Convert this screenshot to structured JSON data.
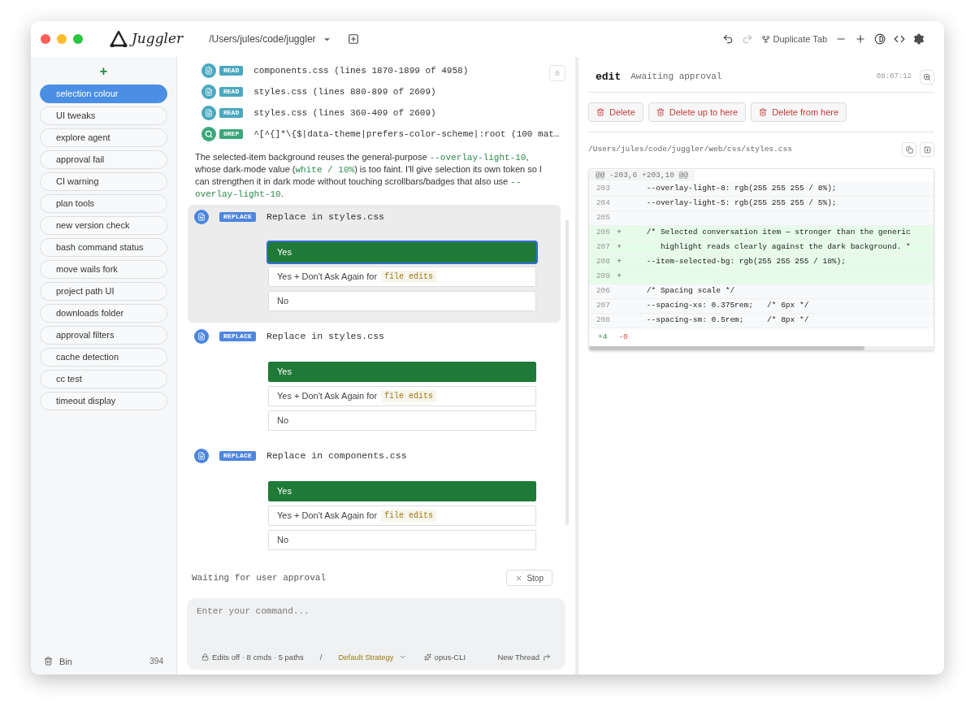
{
  "window": {
    "app_name": "Juggler",
    "project_path": "/Users/jules/code/juggler",
    "toolbar": {
      "duplicate_label": "Duplicate Tab",
      "redo_disabled": true
    }
  },
  "sidebar": {
    "new_button": "+",
    "items": [
      {
        "label": "selection colour",
        "selected": true
      },
      {
        "label": "UI tweaks",
        "selected": false
      },
      {
        "label": "explore agent",
        "selected": false
      },
      {
        "label": "approval fail",
        "selected": false
      },
      {
        "label": "CI warning",
        "selected": false
      },
      {
        "label": "plan tools",
        "selected": false
      },
      {
        "label": "new version check",
        "selected": false
      },
      {
        "label": "bash command status",
        "selected": false
      },
      {
        "label": "move wails fork",
        "selected": false
      },
      {
        "label": "project path UI",
        "selected": false
      },
      {
        "label": "downloads folder",
        "selected": false
      },
      {
        "label": "approval filters",
        "selected": false
      },
      {
        "label": "cache detection",
        "selected": false
      },
      {
        "label": "cc test",
        "selected": false
      },
      {
        "label": "timeout display",
        "selected": false
      }
    ],
    "bin": {
      "label": "Bin",
      "count": "394"
    }
  },
  "conversation": {
    "tool_calls": [
      {
        "kind": "read",
        "badge": "READ",
        "text": "components.css (lines 1870-1899 of 4958)"
      },
      {
        "kind": "read",
        "badge": "READ",
        "text": "styles.css (lines 880-899 of 2609)"
      },
      {
        "kind": "read",
        "badge": "READ",
        "text": "styles.css (lines 360-409 of 2609)"
      },
      {
        "kind": "grep",
        "badge": "GREP",
        "text": "^[^{]*\\{$|data-theme|prefers-color-scheme|:root (100 mat…"
      }
    ],
    "message": [
      {
        "text": "The selected-item background reuses the general-purpose ",
        "code": false
      },
      {
        "text": "--overlay-light-10",
        "code": true
      },
      {
        "text": ", whose dark-mode value (",
        "code": false
      },
      {
        "text": "white / 10%",
        "code": true
      },
      {
        "text": ") is too faint. I'll give selection its own token so I can strengthen it in dark mode without touching scrollbars/badges that also use ",
        "code": false
      },
      {
        "text": "--overlay-light-10",
        "code": true
      },
      {
        "text": ".",
        "code": false
      }
    ],
    "approvals": [
      {
        "badge": "REPLACE",
        "title": "Replace in styles.css",
        "selected": true,
        "options": [
          {
            "kind": "primary",
            "label": "Yes",
            "focused": true
          },
          {
            "kind": "remember",
            "label": "Yes + Don't Ask Again for",
            "code": "file edits",
            "focused": false
          },
          {
            "kind": "plain",
            "label": "No",
            "focused": false
          }
        ]
      },
      {
        "badge": "REPLACE",
        "title": "Replace in styles.css",
        "selected": false,
        "options": [
          {
            "kind": "primary",
            "label": "Yes",
            "focused": false
          },
          {
            "kind": "remember",
            "label": "Yes + Don't Ask Again for",
            "code": "file edits",
            "focused": false
          },
          {
            "kind": "plain",
            "label": "No",
            "focused": false
          }
        ]
      },
      {
        "badge": "REPLACE",
        "title": "Replace in components.css",
        "selected": false,
        "options": [
          {
            "kind": "primary",
            "label": "Yes",
            "focused": false
          },
          {
            "kind": "remember",
            "label": "Yes + Don't Ask Again for",
            "code": "file edits",
            "focused": false
          },
          {
            "kind": "plain",
            "label": "No",
            "focused": false
          }
        ]
      }
    ],
    "status": "Waiting for user approval",
    "stop_button": "Stop"
  },
  "composer": {
    "placeholder": "Enter your command...",
    "permissions": "Edits off · 8 cmds · 5 paths",
    "separator": "/",
    "strategy": "Default Strategy",
    "model": "opus-CLI",
    "new_thread": "New Thread"
  },
  "detail": {
    "tool": "edit",
    "state": "Awaiting approval",
    "time": "08:07:12",
    "actions": [
      "Delete",
      "Delete up to here",
      "Delete from here"
    ],
    "file_path": "/Users/jules/code/juggler/web/css/styles.css",
    "diff": {
      "hunk": "@@ -203,6 +203,10 @@",
      "lines": [
        {
          "kind": "context",
          "number": "203",
          "code": "    --overlay-light-8: rgb(255 255 255 / 8%);"
        },
        {
          "kind": "context",
          "number": "204",
          "code": "    --overlay-light-5: rgb(255 255 255 / 5%);"
        },
        {
          "kind": "context",
          "number": "205"
        },
        {
          "kind": "added",
          "number": "206",
          "sign": "+",
          "code": "    /* Selected conversation item — stronger than the generic"
        },
        {
          "kind": "added",
          "number": "207",
          "sign": "+",
          "code": "       highlight reads clearly against the dark background. *"
        },
        {
          "kind": "added",
          "number": "208",
          "sign": "+",
          "code": "    --item-selected-bg: rgb(255 255 255 / 18%);"
        },
        {
          "kind": "added",
          "number": "209",
          "sign": "+"
        },
        {
          "kind": "context",
          "number": "206",
          "code": "    /* Spacing scale */"
        },
        {
          "kind": "context",
          "number": "207",
          "code": "    --spacing-xs: 0.375rem;   /* 6px */"
        },
        {
          "kind": "context",
          "number": "208",
          "code": "    --spacing-sm: 0.5rem;     /* 8px */"
        }
      ],
      "added": "+4",
      "removed": "-0"
    }
  }
}
